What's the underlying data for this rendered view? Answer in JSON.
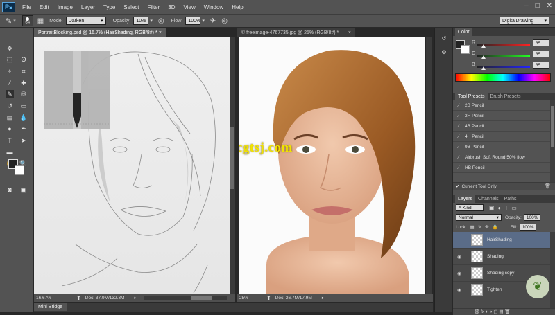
{
  "app": {
    "logo": "Ps",
    "window_controls": [
      "–",
      "□",
      "✕"
    ]
  },
  "menu": [
    "File",
    "Edit",
    "Image",
    "Layer",
    "Type",
    "Select",
    "Filter",
    "3D",
    "View",
    "Window",
    "Help"
  ],
  "options": {
    "brush_size": "64",
    "mode_label": "Mode:",
    "mode_value": "Darken",
    "opacity_label": "Opacity:",
    "opacity_value": "10%",
    "flow_label": "Flow:",
    "flow_value": "100%",
    "workspace": "DigitalDrawing"
  },
  "documents": [
    {
      "tab": "PortraitBlocking.psd @ 16.7% (HairShading, RGB/8#) *",
      "zoom": "16.67%",
      "doc": "Doc: 37.9M/132.3M"
    },
    {
      "tab": "© freeimage-4767735.jpg @ 25% (RGB/8#) *",
      "zoom": "25%",
      "doc": "Doc: 26.7M/17.9M"
    }
  ],
  "watermark": "www.cgtsj.com",
  "color_panel": {
    "title": "Color",
    "r_label": "R",
    "r_value": "35",
    "g_label": "G",
    "g_value": "35",
    "b_label": "B",
    "b_value": "35"
  },
  "tool_presets": {
    "tabs": [
      "Tool Presets",
      "Brush Presets"
    ],
    "items": [
      "2B Pencil",
      "2H Pencil",
      "4B Pencil",
      "4H Pencil",
      "9B Pencil",
      "Airbrush Soft Round 50% flow",
      "HB Pencil"
    ],
    "current_tool_only": "Current Tool Only"
  },
  "layers_panel": {
    "tabs": [
      "Layers",
      "Channels",
      "Paths"
    ],
    "kind": "Kind",
    "blend_mode": "Normal",
    "opacity_label": "Opacity:",
    "opacity_value": "100%",
    "lock_label": "Lock:",
    "fill_label": "Fill:",
    "fill_value": "100%",
    "layers": [
      "HairShading",
      "Shading",
      "Shading copy",
      "Tighten"
    ],
    "footer_icons": "⛓  fx  ◐  ◑  ▢  ▤  🗑"
  },
  "mini_bridge": "Mini Bridge",
  "colors": {
    "accent": "#5a6c88",
    "foreground": "#232323",
    "watermark": "#f2e300"
  }
}
